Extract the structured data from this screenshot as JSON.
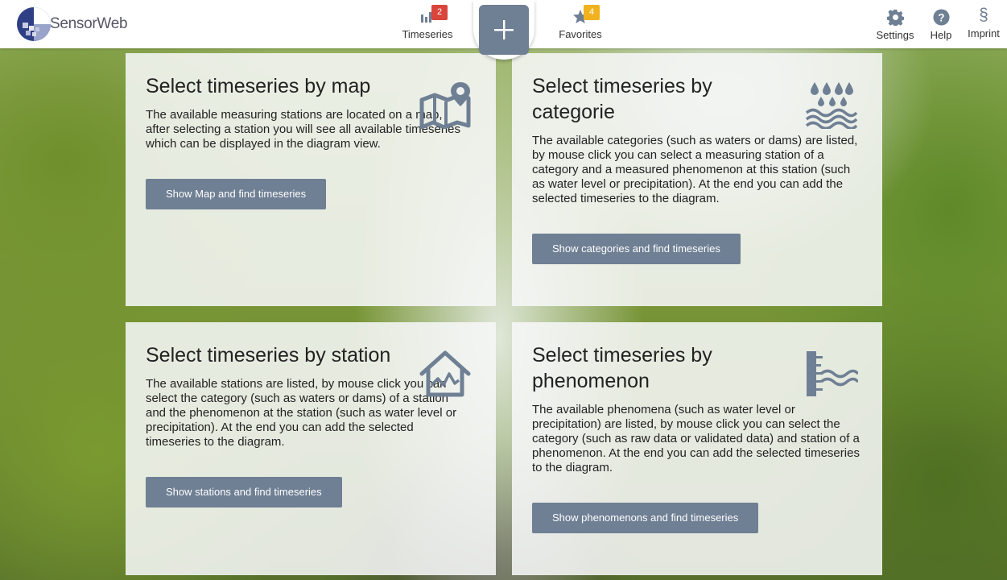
{
  "header": {
    "logo_text": "SensorWeb",
    "nav": {
      "timeseries": {
        "label": "Timeseries",
        "badge": "2"
      },
      "favorites": {
        "label": "Favorites",
        "badge": "4"
      },
      "settings": {
        "label": "Settings"
      },
      "help": {
        "label": "Help"
      },
      "imprint": {
        "label": "Imprint",
        "glyph": "§"
      }
    },
    "add_icon": "plus-icon"
  },
  "colors": {
    "accent": "#6f7f94",
    "badge_red": "#d9443b",
    "badge_yellow": "#f0b21e"
  },
  "cards": [
    {
      "title": "Select timeseries by map",
      "text": "The available measuring stations are located on a map, after selecting a station you will see all available timeseries which can be displayed in the diagram view.",
      "button": "Show Map and find timeseries",
      "icon": "map-pin-icon"
    },
    {
      "title": "Select timeseries by categorie",
      "text": "The available categories (such as waters or dams) are listed, by mouse click you can select a measuring station of a category and a measured phenomenon at this station (such as water level or precipitation). At the end you can add the selected timeseries to the diagram.",
      "button": "Show categories and find timeseries",
      "icon": "rain-waves-icon"
    },
    {
      "title": "Select timeseries by station",
      "text": "The available stations are listed, by mouse click you can select the category (such as waters or dams) of a station and the phenomenon at the station (such as water level or precipitation). At the end you can add the selected timeseries to the diagram.",
      "button": "Show stations and find timeseries",
      "icon": "station-house-icon"
    },
    {
      "title": "Select timeseries by phenomenon",
      "text": "The available phenomena (such as water level or precipitation) are listed, by mouse click you can select the category (such as raw data or validated data) and station of a phenomenon. At the end you can add the selected timeseries to the diagram.",
      "button": "Show phenomenons and find timeseries",
      "icon": "water-gauge-icon"
    }
  ]
}
